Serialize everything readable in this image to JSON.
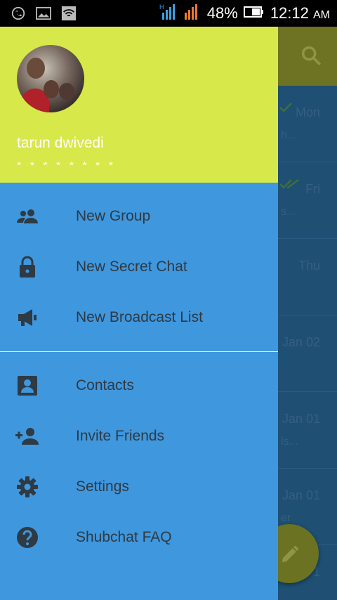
{
  "status_bar": {
    "battery": "48%",
    "time": "12:12",
    "ampm": "AM",
    "icons": [
      "whatsapp-icon",
      "gallery-icon",
      "wifi-icon",
      "signal-icon",
      "battery-icon"
    ]
  },
  "drawer": {
    "user_name": "tarun dwivedi",
    "phone": "* * * * * * * *",
    "colors": {
      "header": "#d7e84a",
      "body": "#3f97de",
      "text": "#2e3a44"
    },
    "group1": [
      {
        "label": "New Group",
        "icon": "group-icon"
      },
      {
        "label": "New Secret Chat",
        "icon": "lock-icon"
      },
      {
        "label": "New Broadcast List",
        "icon": "broadcast-icon"
      }
    ],
    "group2": [
      {
        "label": "Contacts",
        "icon": "contacts-icon"
      },
      {
        "label": "Invite Friends",
        "icon": "add-person-icon"
      },
      {
        "label": "Settings",
        "icon": "gear-icon"
      },
      {
        "label": "Shubchat FAQ",
        "icon": "help-icon"
      }
    ]
  },
  "background_list": {
    "rows": [
      {
        "date": "Mon",
        "sub": "h..."
      },
      {
        "date": "Fri",
        "sub": "s..."
      },
      {
        "date": "Thu",
        "sub": ""
      },
      {
        "date": "Jan 02",
        "sub": ""
      },
      {
        "date": "Jan 01",
        "sub": "ls..."
      },
      {
        "date": "Jan 01",
        "sub": "er"
      },
      {
        "date": "1",
        "sub": ""
      }
    ]
  }
}
